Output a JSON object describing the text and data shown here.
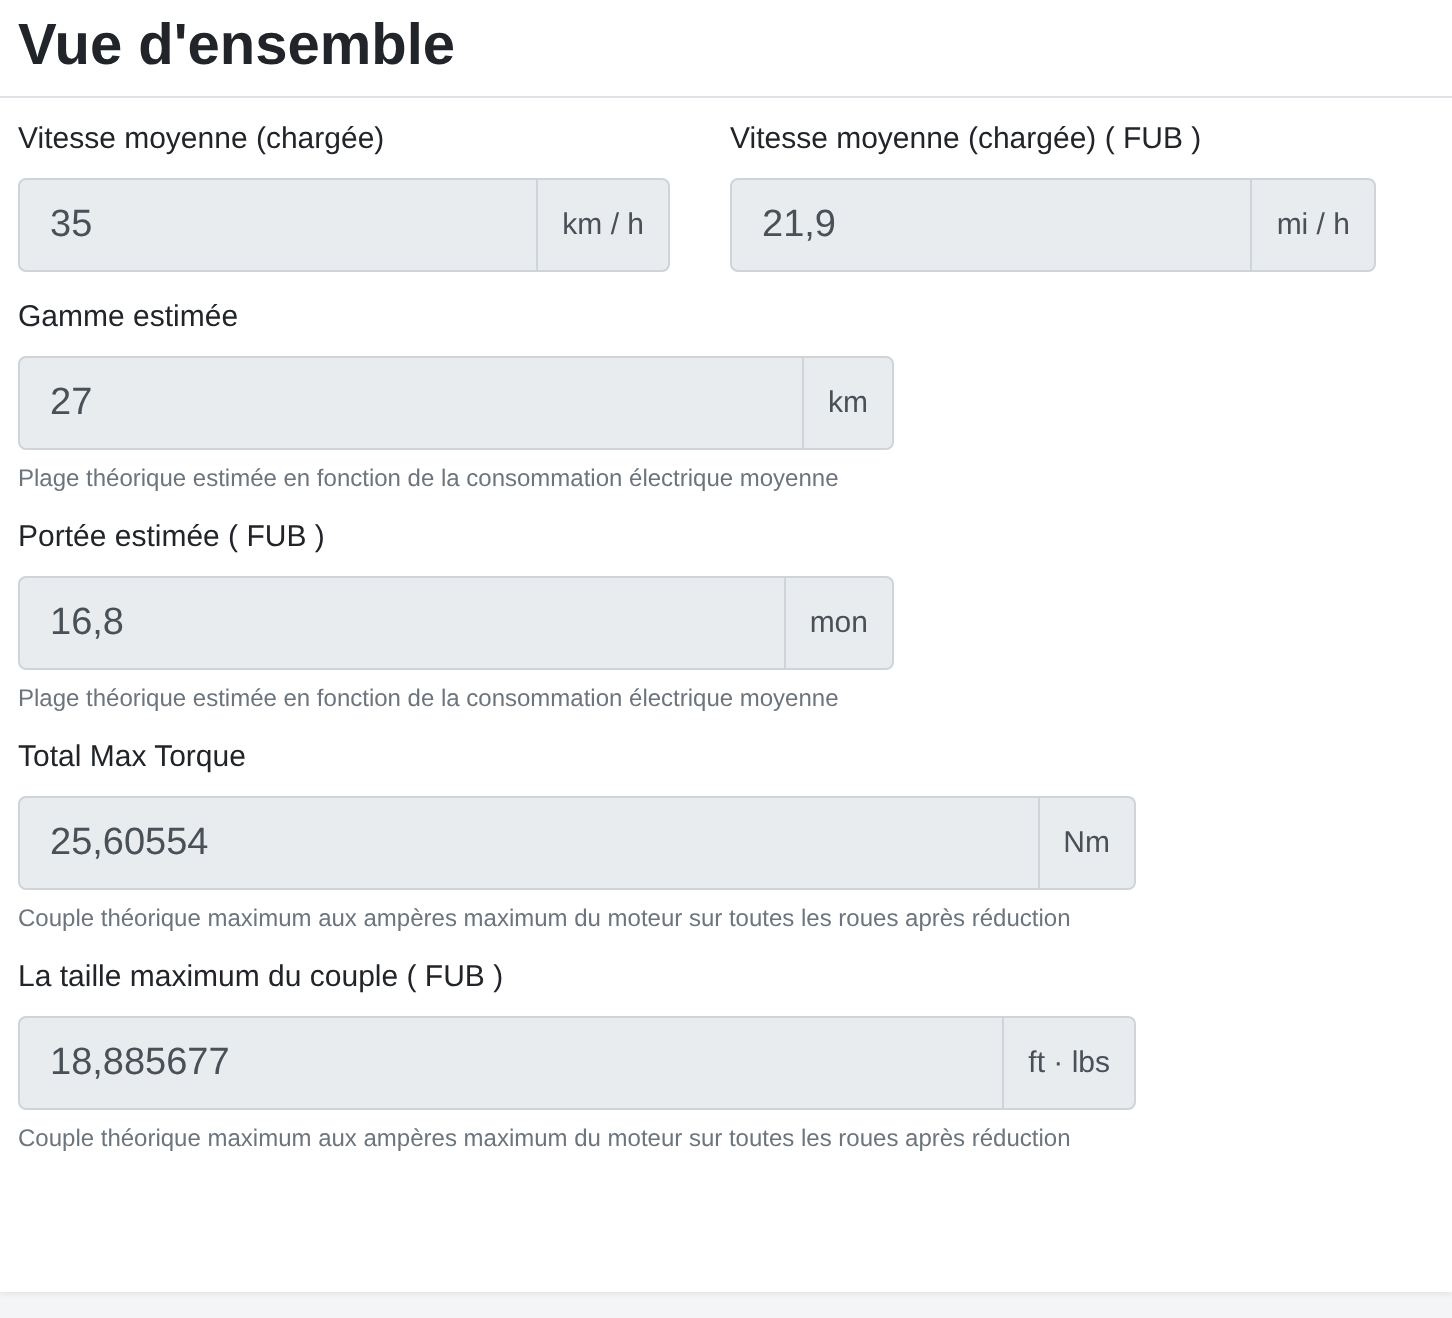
{
  "title": "Vue d'ensemble",
  "rows": [
    {
      "fields": [
        {
          "label": "Vitesse moyenne (chargée)",
          "value": "35",
          "unit": "km / h"
        },
        {
          "label": "Vitesse moyenne (chargée) ( FUB )",
          "value": "21,9",
          "unit": "mi / h"
        }
      ]
    },
    {
      "fields": [
        {
          "label": "Gamme estimée",
          "value": "27",
          "unit": "km",
          "help": "Plage théorique estimée en fonction de la consommation électrique moyenne"
        }
      ]
    },
    {
      "fields": [
        {
          "label": "Portée estimée ( FUB )",
          "value": "16,8",
          "unit": "mon",
          "help": "Plage théorique estimée en fonction de la consommation électrique moyenne"
        }
      ]
    },
    {
      "fields": [
        {
          "label": "Total Max Torque",
          "value": "25,60554",
          "unit": "Nm",
          "help": "Couple théorique maximum aux ampères maximum du moteur sur toutes les roues après réduction"
        }
      ]
    },
    {
      "fields": [
        {
          "label": "La taille maximum du couple ( FUB )",
          "value": "18,885677",
          "unit": "ft · lbs",
          "help": "Couple théorique maximum aux ampères maximum du moteur sur toutes les roues après réduction"
        }
      ]
    }
  ]
}
